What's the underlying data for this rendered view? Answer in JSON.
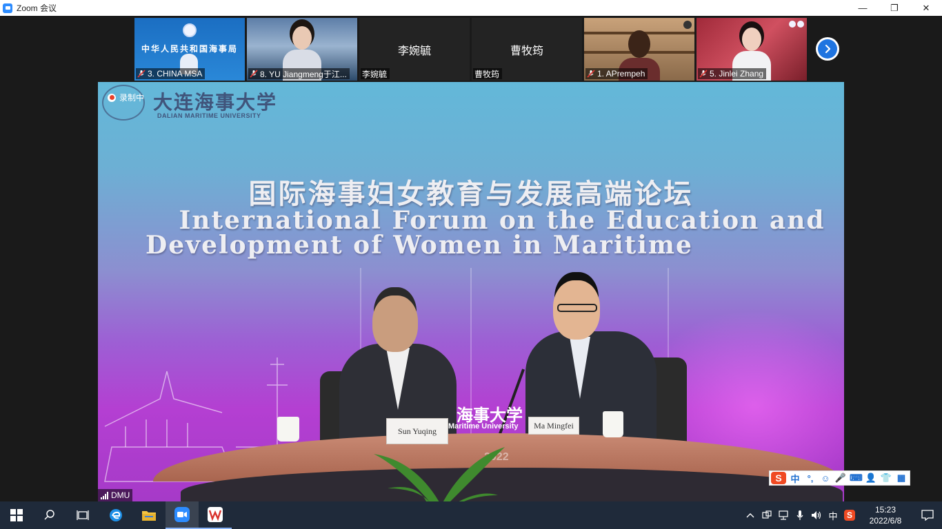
{
  "window": {
    "title": "Zoom 会议",
    "minimize": "—",
    "maximize": "❐",
    "close": "✕"
  },
  "participants": [
    {
      "label": "3. CHINA MSA",
      "banner": "中华人民共和国海事局",
      "muted": true
    },
    {
      "label": "8. YU Jiangmeng于江...",
      "muted": true
    },
    {
      "label": "李婉毓",
      "center_name": "李婉毓",
      "muted": false
    },
    {
      "label": "曹牧筠",
      "center_name": "曹牧筠",
      "muted": false
    },
    {
      "label": "1. APrempeh",
      "muted": true
    },
    {
      "label": "5. Jinlei Zhang",
      "muted": true
    }
  ],
  "main_video": {
    "recording_label": "录制中",
    "university_cn": "大连海事大学",
    "university_en": "DALIAN MARITIME UNIVERSITY",
    "forum_title_cn": "国际海事妇女教育与发展高端论坛",
    "forum_title_en_line1": "International Forum on the Education and",
    "forum_title_en_line2": "Development of Women in Maritime",
    "backdrop_text": "海事大学",
    "backdrop_text_en": "Maritime University",
    "year_text": "2022",
    "nameplate_left": "Sun Yuqing",
    "nameplate_right": "Ma Mingfei",
    "speaker_label": "DMU"
  },
  "ime_bar": {
    "brand": "S",
    "items": [
      "中",
      "°,",
      "☺",
      "🎤",
      "⌨",
      "👤",
      "👕",
      "▦"
    ]
  },
  "taskbar": {
    "time": "15:23",
    "date": "2022/6/8",
    "ime_lang": "中",
    "tray_sogou": "S"
  }
}
